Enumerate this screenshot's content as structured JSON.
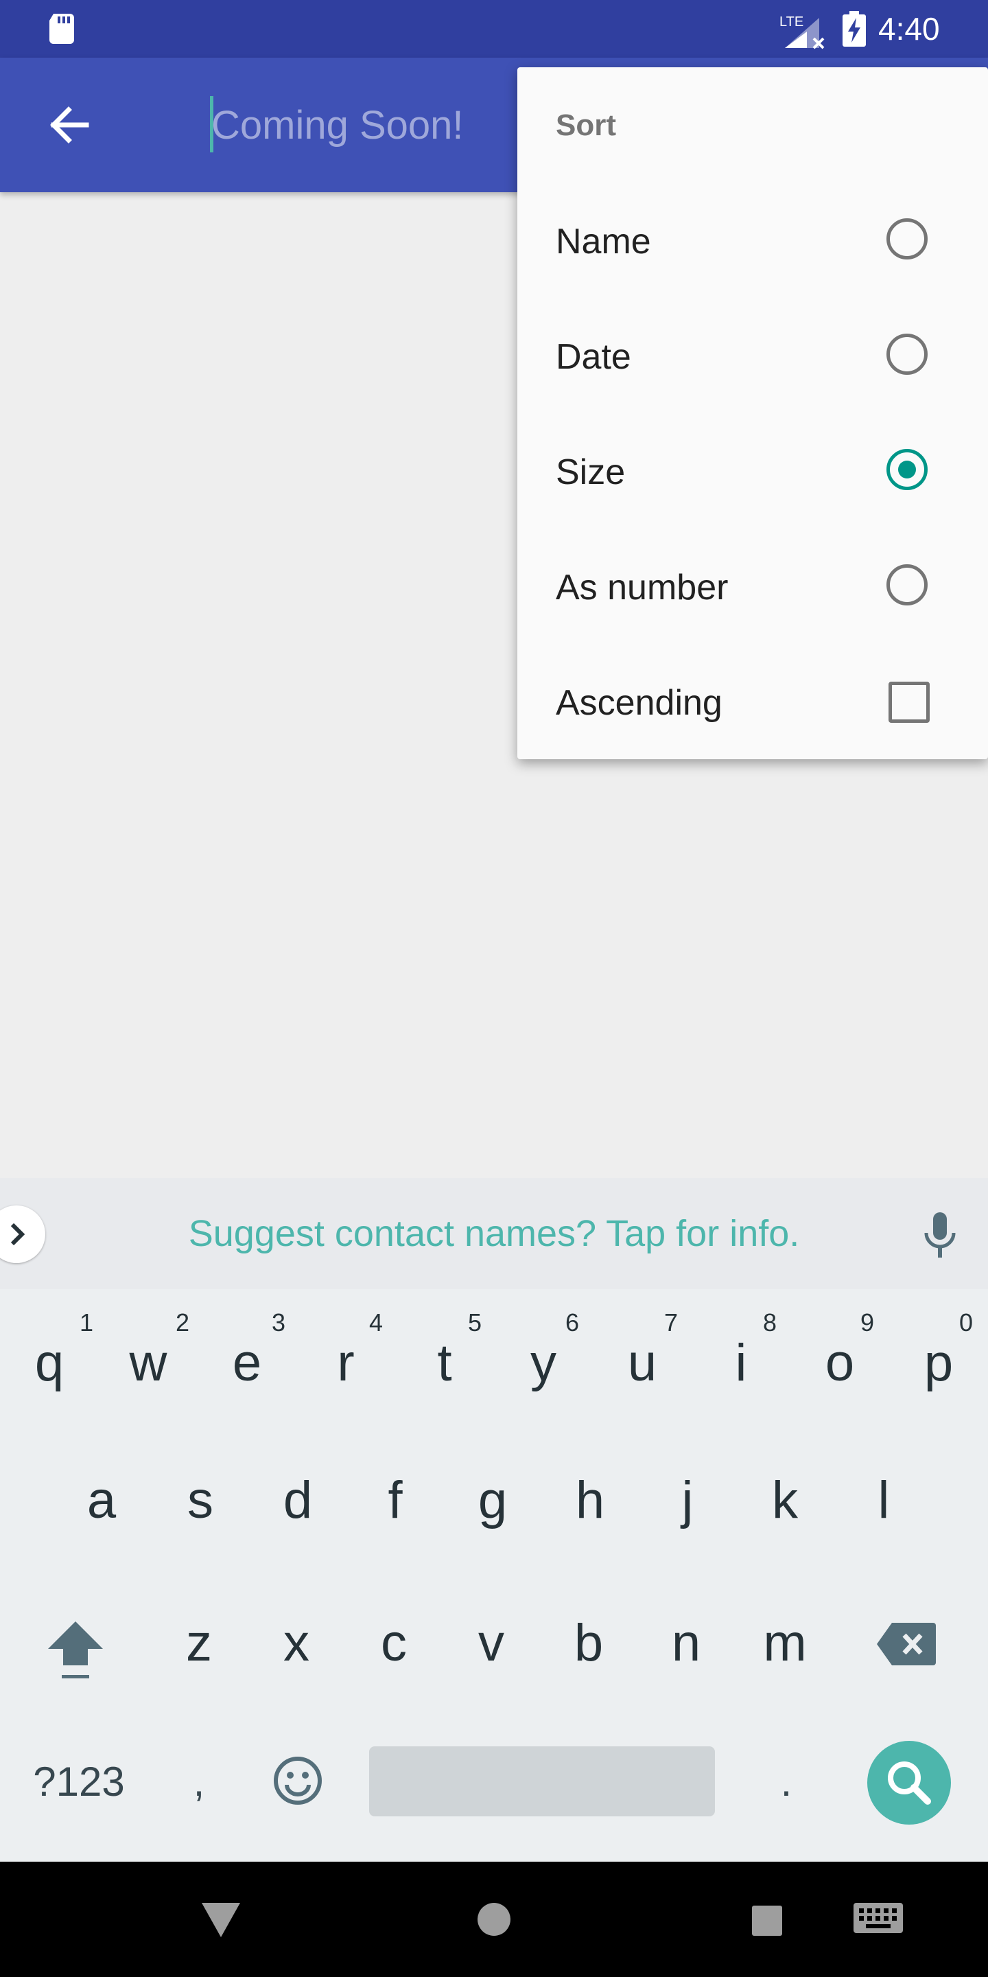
{
  "status_bar": {
    "time": "4:40",
    "network_label": "LTE",
    "icons": [
      "sd-card-icon",
      "lte-signal-icon",
      "battery-charging-icon"
    ]
  },
  "toolbar": {
    "back_icon": "arrow-back-icon",
    "search_placeholder": "Coming Soon!",
    "search_value": ""
  },
  "sort_menu": {
    "title": "Sort",
    "options": [
      {
        "label": "Name",
        "type": "radio",
        "selected": false
      },
      {
        "label": "Date",
        "type": "radio",
        "selected": false
      },
      {
        "label": "Size",
        "type": "radio",
        "selected": true
      },
      {
        "label": "As number",
        "type": "radio",
        "selected": false
      },
      {
        "label": "Ascending",
        "type": "checkbox",
        "checked": false
      }
    ]
  },
  "keyboard": {
    "suggestion_text": "Suggest contact names? Tap for info.",
    "row1": [
      "q",
      "w",
      "e",
      "r",
      "t",
      "y",
      "u",
      "i",
      "o",
      "p"
    ],
    "row1_hints": [
      "1",
      "2",
      "3",
      "4",
      "5",
      "6",
      "7",
      "8",
      "9",
      "0"
    ],
    "row2": [
      "a",
      "s",
      "d",
      "f",
      "g",
      "h",
      "j",
      "k",
      "l"
    ],
    "row3": [
      "z",
      "x",
      "c",
      "v",
      "b",
      "n",
      "m"
    ],
    "symbols_label": "?123",
    "comma_label": ",",
    "period_label": ".",
    "action_icon": "search-icon"
  },
  "colors": {
    "status_bar": "#303f9f",
    "toolbar": "#3f51b5",
    "accent": "#009688",
    "suggestion_text": "#4db6ac"
  }
}
